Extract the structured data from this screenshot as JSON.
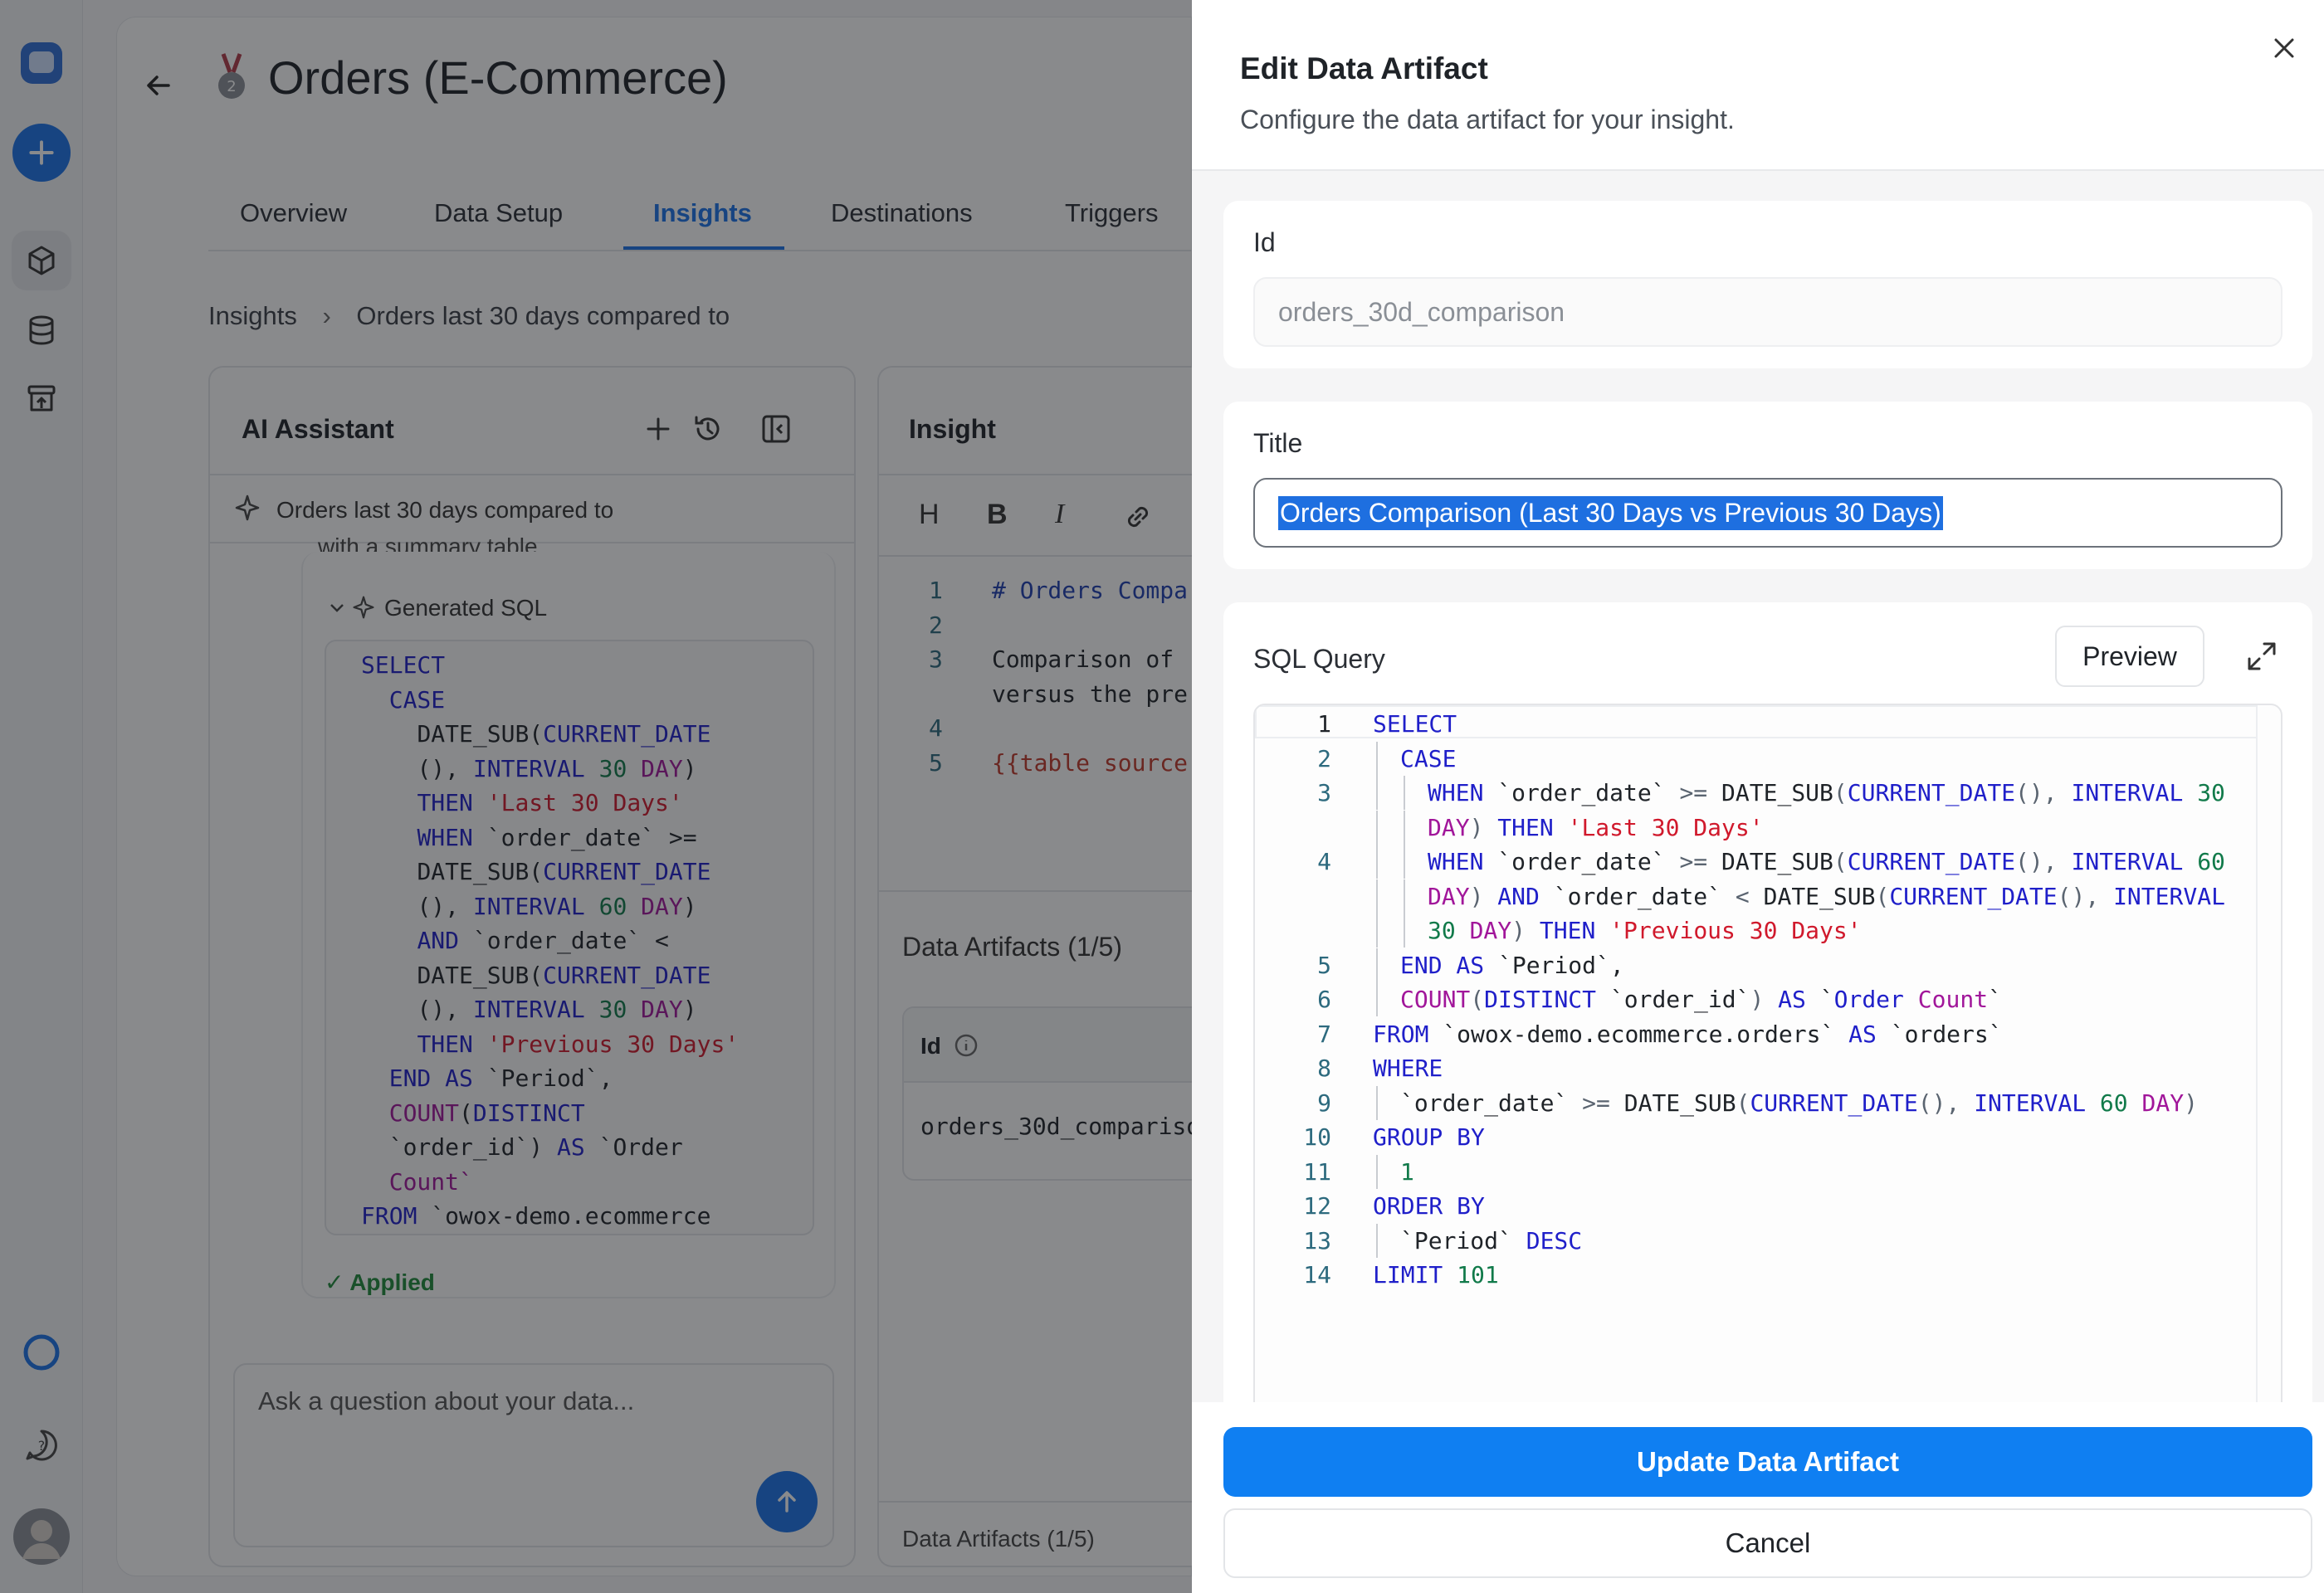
{
  "background": {
    "page_title": "Orders (E-Commerce)",
    "tabs": [
      {
        "label": "Overview",
        "active": false
      },
      {
        "label": "Data Setup",
        "active": false
      },
      {
        "label": "Insights",
        "active": true
      },
      {
        "label": "Destinations",
        "active": false
      },
      {
        "label": "Triggers",
        "active": false
      }
    ],
    "breadcrumb": {
      "root": "Insights",
      "current": "Orders last 30 days compared to"
    },
    "ai_assistant": {
      "title": "AI Assistant",
      "context_chip": "Orders last 30 days compared to",
      "truncated_text": "with a summary table.",
      "generated_sql_label": "Generated SQL",
      "applied_label": "Applied",
      "ask_placeholder": "Ask a question about your data...",
      "sql_lines": [
        "SELECT",
        "  CASE",
        "    DATE_SUB(CURRENT_DATE",
        "    (), INTERVAL 30 DAY)",
        "    THEN 'Last 30 Days'",
        "    WHEN `order_date` >=",
        "    DATE_SUB(CURRENT_DATE",
        "    (), INTERVAL 60 DAY)",
        "    AND `order_date` <",
        "    DATE_SUB(CURRENT_DATE",
        "    (), INTERVAL 30 DAY)",
        "    THEN 'Previous 30 Days'",
        "  END AS `Period`,",
        "  COUNT(DISTINCT",
        "  `order_id`) AS `Order",
        "  Count`",
        "FROM `owox-demo.ecommerce"
      ]
    },
    "insight": {
      "title": "Insight",
      "toolbar": [
        "H",
        "B",
        "I"
      ],
      "editor_lines": [
        {
          "n": "1",
          "text": "# Orders Compa"
        },
        {
          "n": "2",
          "text": ""
        },
        {
          "n": "3",
          "text": "Comparison of"
        },
        {
          "n": "",
          "text": "versus the pre"
        },
        {
          "n": "4",
          "text": ""
        },
        {
          "n": "5",
          "text": "{{table source"
        }
      ],
      "artifacts_heading": "Data Artifacts (1/5)",
      "artifacts_id_col": "Id",
      "artifacts_id_value": "orders_30d_compariso",
      "footer_label": "Data Artifacts (1/5)"
    }
  },
  "drawer": {
    "title": "Edit Data Artifact",
    "subtitle": "Configure the data artifact for your insight.",
    "id_label": "Id",
    "id_value": "orders_30d_comparison",
    "title_label": "Title",
    "title_value": "Orders Comparison (Last 30 Days vs Previous 30 Days)",
    "sql_label": "SQL Query",
    "preview_label": "Preview",
    "sql_lines": [
      {
        "n": "1",
        "indent": 0,
        "tokens": [
          [
            "kw",
            "SELECT"
          ]
        ]
      },
      {
        "n": "2",
        "indent": 1,
        "tokens": [
          [
            "kw",
            "CASE"
          ]
        ]
      },
      {
        "n": "3",
        "indent": 2,
        "tokens": [
          [
            "kw",
            "WHEN "
          ],
          [
            "id",
            "`order_date` "
          ],
          [
            "op",
            ">= "
          ],
          [
            "id",
            "DATE_SUB"
          ],
          [
            "op",
            "("
          ],
          [
            "kw",
            "CURRENT_DATE"
          ],
          [
            "op",
            "(), "
          ],
          [
            "kw",
            "INTERVAL "
          ],
          [
            "num",
            "30"
          ]
        ]
      },
      {
        "n": "",
        "indent": 2,
        "tokens": [
          [
            "fn",
            "DAY"
          ],
          [
            "op",
            ") "
          ],
          [
            "kw",
            "THEN "
          ],
          [
            "str",
            "'Last 30 Days'"
          ]
        ]
      },
      {
        "n": "4",
        "indent": 2,
        "tokens": [
          [
            "kw",
            "WHEN "
          ],
          [
            "id",
            "`order_date` "
          ],
          [
            "op",
            ">= "
          ],
          [
            "id",
            "DATE_SUB"
          ],
          [
            "op",
            "("
          ],
          [
            "kw",
            "CURRENT_DATE"
          ],
          [
            "op",
            "(), "
          ],
          [
            "kw",
            "INTERVAL "
          ],
          [
            "num",
            "60"
          ]
        ]
      },
      {
        "n": "",
        "indent": 2,
        "tokens": [
          [
            "fn",
            "DAY"
          ],
          [
            "op",
            ") "
          ],
          [
            "kw",
            "AND "
          ],
          [
            "id",
            "`order_date` "
          ],
          [
            "op",
            "< "
          ],
          [
            "id",
            "DATE_SUB"
          ],
          [
            "op",
            "("
          ],
          [
            "kw",
            "CURRENT_DATE"
          ],
          [
            "op",
            "(), "
          ],
          [
            "kw",
            "INTERVAL"
          ]
        ]
      },
      {
        "n": "",
        "indent": 2,
        "tokens": [
          [
            "num",
            "30 "
          ],
          [
            "fn",
            "DAY"
          ],
          [
            "op",
            ") "
          ],
          [
            "kw",
            "THEN "
          ],
          [
            "str",
            "'Previous 30 Days'"
          ]
        ]
      },
      {
        "n": "5",
        "indent": 1,
        "tokens": [
          [
            "kw",
            "END AS "
          ],
          [
            "id",
            "`Period`,"
          ]
        ]
      },
      {
        "n": "6",
        "indent": 1,
        "tokens": [
          [
            "fn",
            "COUNT"
          ],
          [
            "op",
            "("
          ],
          [
            "kw",
            "DISTINCT "
          ],
          [
            "id",
            "`order_id`"
          ],
          [
            "op",
            ") "
          ],
          [
            "kw",
            "AS "
          ],
          [
            "id",
            "`"
          ],
          [
            "kw",
            "Order "
          ],
          [
            "fn",
            "Count"
          ],
          [
            "id",
            "`"
          ]
        ]
      },
      {
        "n": "7",
        "indent": 0,
        "tokens": [
          [
            "kw",
            "FROM "
          ],
          [
            "id",
            "`owox-demo.ecommerce.orders` "
          ],
          [
            "kw",
            "AS "
          ],
          [
            "id",
            "`orders`"
          ]
        ]
      },
      {
        "n": "8",
        "indent": 0,
        "tokens": [
          [
            "kw",
            "WHERE"
          ]
        ]
      },
      {
        "n": "9",
        "indent": 1,
        "tokens": [
          [
            "id",
            "`order_date` "
          ],
          [
            "op",
            ">= "
          ],
          [
            "id",
            "DATE_SUB"
          ],
          [
            "op",
            "("
          ],
          [
            "kw",
            "CURRENT_DATE"
          ],
          [
            "op",
            "(), "
          ],
          [
            "kw",
            "INTERVAL "
          ],
          [
            "num",
            "60 "
          ],
          [
            "fn",
            "DAY"
          ],
          [
            "op",
            ")"
          ]
        ]
      },
      {
        "n": "10",
        "indent": 0,
        "tokens": [
          [
            "kw",
            "GROUP BY"
          ]
        ]
      },
      {
        "n": "11",
        "indent": 1,
        "tokens": [
          [
            "num",
            "1"
          ]
        ]
      },
      {
        "n": "12",
        "indent": 0,
        "tokens": [
          [
            "kw",
            "ORDER BY"
          ]
        ]
      },
      {
        "n": "13",
        "indent": 1,
        "tokens": [
          [
            "id",
            "`Period` "
          ],
          [
            "kw",
            "DESC"
          ]
        ]
      },
      {
        "n": "14",
        "indent": 0,
        "tokens": [
          [
            "kw",
            "LIMIT "
          ],
          [
            "num",
            "101"
          ]
        ]
      }
    ],
    "update_button": "Update Data Artifact",
    "cancel_button": "Cancel"
  },
  "icons": {
    "close": "close-icon",
    "expand": "expand-icon",
    "back": "arrow-left-icon",
    "plus": "plus-icon",
    "history": "history-icon",
    "panel": "panel-collapse-icon",
    "sparkle": "sparkle-icon",
    "chevron": "chevron-down-icon",
    "check": "check-icon",
    "send": "arrow-up-icon",
    "info": "info-icon",
    "link": "link-icon"
  },
  "colors": {
    "accent": "#0f7ff2",
    "applied": "#1f8a3a",
    "selection": "#1e6fe0"
  }
}
